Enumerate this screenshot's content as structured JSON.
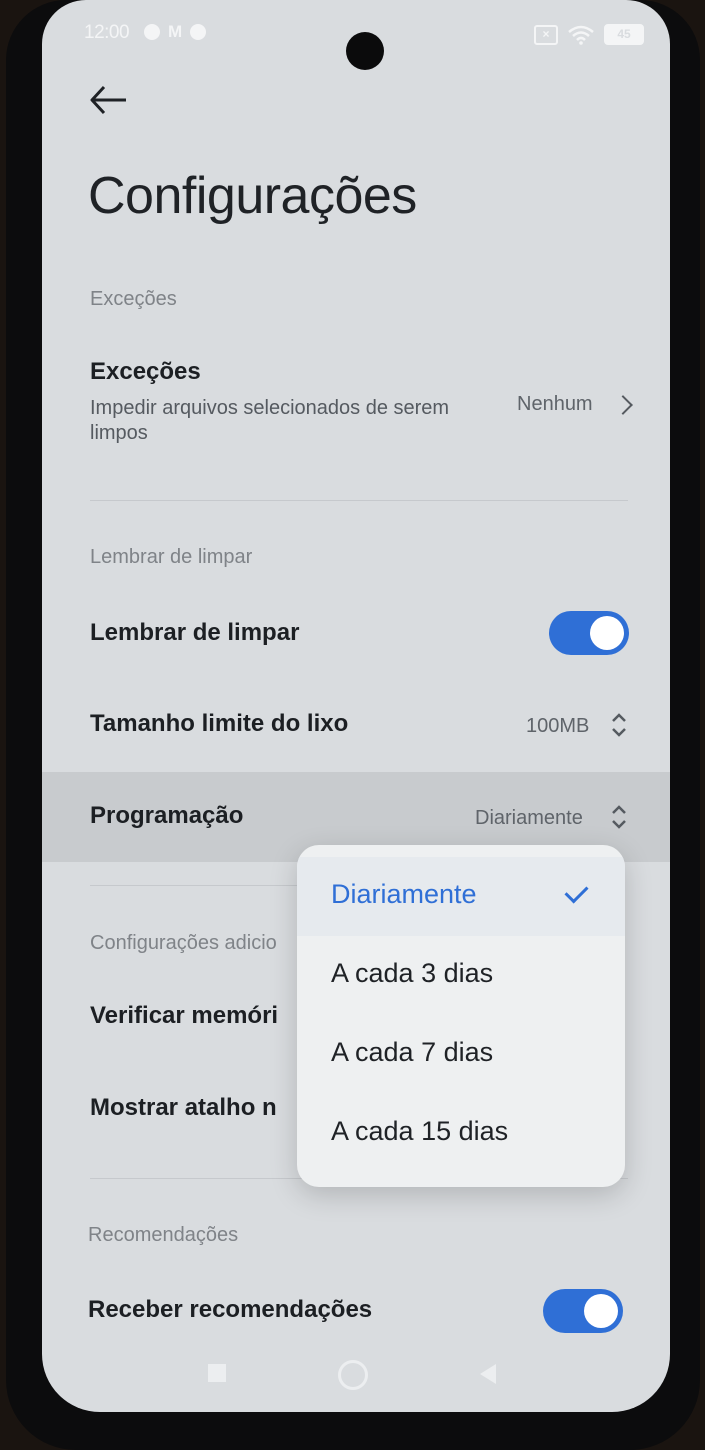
{
  "status_bar": {
    "time": "12:00",
    "battery": "45"
  },
  "header": {
    "title": "Configurações"
  },
  "sections": {
    "exceptions_header": "Exceções",
    "exceptions": {
      "title": "Exceções",
      "subtitle": "Impedir arquivos selecionados de serem limpos",
      "value": "Nenhum"
    },
    "remind_header": "Lembrar de limpar",
    "remind_toggle": {
      "label": "Lembrar de limpar",
      "on": true
    },
    "size_limit": {
      "label": "Tamanho limite do lixo",
      "value": "100MB"
    },
    "schedule": {
      "label": "Programação",
      "value": "Diariamente"
    },
    "additional_header": "Configurações adicio",
    "check_memory": {
      "label": "Verificar memóri"
    },
    "show_shortcut": {
      "label": "Mostrar atalho n"
    },
    "recommendations_header": "Recomendações",
    "receive_recommendations": {
      "label": "Receber recomendações",
      "on": true
    }
  },
  "dropdown": {
    "options": [
      {
        "label": "Diariamente",
        "selected": true
      },
      {
        "label": "A cada 3 dias",
        "selected": false
      },
      {
        "label": "A cada 7 dias",
        "selected": false
      },
      {
        "label": "A cada 15 dias",
        "selected": false
      }
    ]
  },
  "colors": {
    "accent": "#2f6fd6",
    "background": "#d9dcdf",
    "menu_bg": "#eef0f1"
  },
  "icons": [
    "back-arrow-icon",
    "chevron-right-icon",
    "updown-arrows-icon",
    "check-icon",
    "wifi-icon",
    "battery-icon"
  ]
}
